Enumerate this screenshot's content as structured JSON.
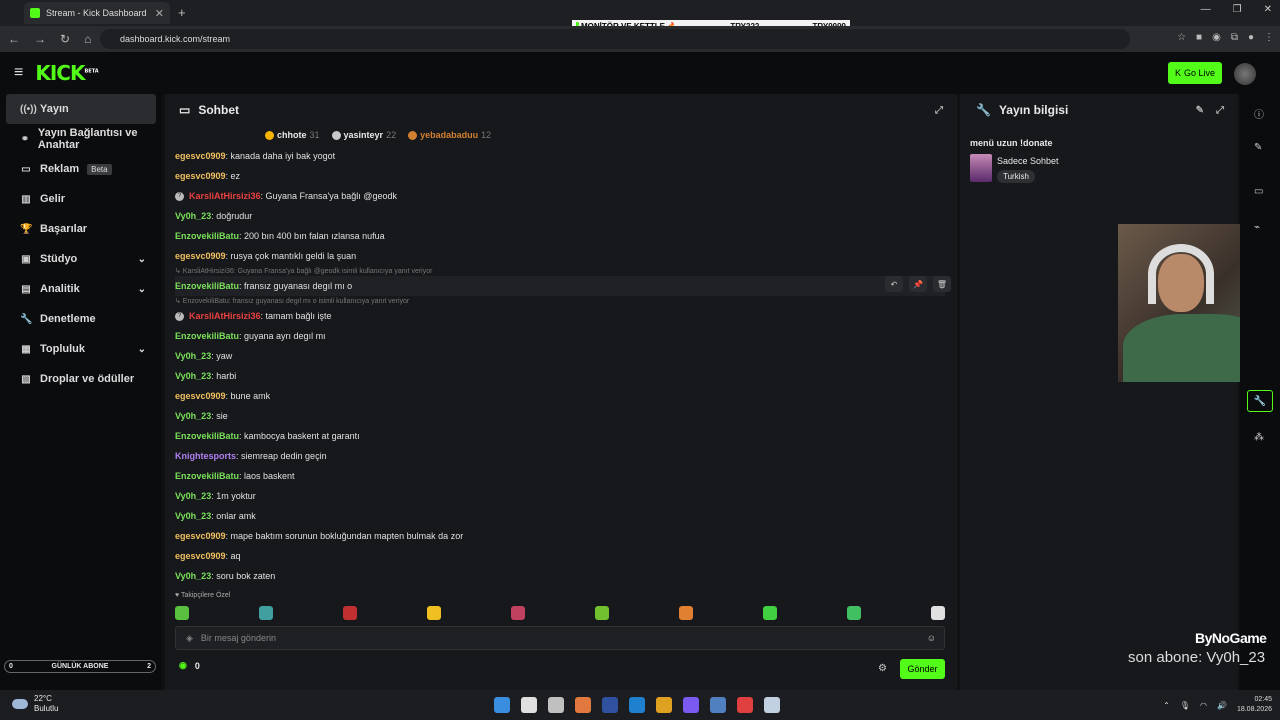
{
  "browser": {
    "tab_title": "Stream - Kick Dashboard",
    "tab_close": "✕",
    "new_tab": "+",
    "url": "dashboard.kick.com/stream",
    "window_controls": [
      "—",
      "❐",
      "✕"
    ]
  },
  "ticker": {
    "label": "MONİTÖR VE KETTLE 🔥",
    "a": "TRY222",
    "b": "TRY9999"
  },
  "header": {
    "logo": "KICK",
    "logo_sup": "BETA",
    "go_live": "Go Live"
  },
  "sidebar": {
    "items": [
      {
        "label": "Yayın",
        "icon": "((•))",
        "active": true
      },
      {
        "label": "Yayın Bağlantısı ve Anahtar",
        "icon": "⚭"
      },
      {
        "label": "Reklam",
        "icon": "▭",
        "badge": "Beta"
      },
      {
        "label": "Gelir",
        "icon": "▥"
      },
      {
        "label": "Başarılar",
        "icon": "🏆"
      },
      {
        "label": "Stüdyo",
        "icon": "▣",
        "chev": "⌄"
      },
      {
        "label": "Analitik",
        "icon": "▤",
        "chev": "⌄"
      },
      {
        "label": "Denetleme",
        "icon": "🔧"
      },
      {
        "label": "Topluluk",
        "icon": "▦",
        "chev": "⌄"
      },
      {
        "label": "Droplar ve ödüller",
        "icon": "▧"
      }
    ],
    "daily": {
      "left": "0",
      "label": "GÜNLÜK ABONE",
      "right": "2"
    }
  },
  "chat": {
    "title": "Sohbet",
    "leaders": [
      {
        "name": "chhote",
        "count": "31",
        "color": "#f5b400"
      },
      {
        "name": "yasinteyr",
        "count": "22",
        "color": "#c8c8c8"
      },
      {
        "name": "yebadabaduu",
        "count": "12",
        "color": "#d08030"
      }
    ],
    "messages": [
      {
        "user": "egesvc0909",
        "color": "#f0c060",
        "text": ": kanada daha iyi bak yogot"
      },
      {
        "user": "egesvc0909",
        "color": "#f0c060",
        "text": ": ez"
      },
      {
        "user": "KarsliAtHirsizi36",
        "color": "#e84040",
        "text": ": Guyana Fransa'ya bağlı @geodk",
        "badge": "?"
      },
      {
        "user": "Vy0h_23",
        "color": "#7ae05a",
        "text": ": doğrudur"
      },
      {
        "user": "EnzovekiliBatu",
        "color": "#7ae05a",
        "text": ": 200 bın 400 bın falan ızlansa nufua"
      },
      {
        "user": "egesvc0909",
        "color": "#f0c060",
        "text": ": rusya çok mantıklı geldi la şuan"
      },
      {
        "reply": "↳ KarsliAtHirsizi36: Guyana Fransa'ya bağlı @geodk isimli kullanıcıya yanıt veriyor"
      },
      {
        "user": "EnzovekiliBatu",
        "color": "#7ae05a",
        "text": ": fransız guyanası degıl mı o",
        "hover": true
      },
      {
        "reply": "↳ EnzovekiliBatu: fransız guyanası degıl mı o isimli kullanıcıya yanıt veriyor"
      },
      {
        "user": "KarsliAtHirsizi36",
        "color": "#e84040",
        "text": ": tamam bağlı işte",
        "badge": "?"
      },
      {
        "user": "EnzovekiliBatu",
        "color": "#7ae05a",
        "text": ": guyana ayrı degıl mı"
      },
      {
        "user": "Vy0h_23",
        "color": "#7ae05a",
        "text": ": yaw"
      },
      {
        "user": "Vy0h_23",
        "color": "#7ae05a",
        "text": ": harbi"
      },
      {
        "user": "egesvc0909",
        "color": "#f0c060",
        "text": ": bune amk"
      },
      {
        "user": "Vy0h_23",
        "color": "#7ae05a",
        "text": ": sie"
      },
      {
        "user": "EnzovekiliBatu",
        "color": "#7ae05a",
        "text": ": kambocya baskent at garantı"
      },
      {
        "user": "Knightesports",
        "color": "#b080f0",
        "text": ": siemreap dedin geçin"
      },
      {
        "user": "EnzovekiliBatu",
        "color": "#7ae05a",
        "text": ": laos baskent"
      },
      {
        "user": "Vy0h_23",
        "color": "#7ae05a",
        "text": ": 1m yoktur"
      },
      {
        "user": "Vy0h_23",
        "color": "#7ae05a",
        "text": ": onlar amk"
      },
      {
        "user": "egesvc0909",
        "color": "#f0c060",
        "text": ": mape baktım sorunun bokluğundan mapten bulmak da zor"
      },
      {
        "user": "egesvc0909",
        "color": "#f0c060",
        "text": ": aq"
      },
      {
        "user": "Vy0h_23",
        "color": "#7ae05a",
        "text": ": soru bok zaten"
      }
    ],
    "followers_only": "♥ Takipçilere Özel",
    "emote_colors": [
      "#5ac040",
      "#40a0a0",
      "#c03030",
      "#f0c020",
      "#c04060",
      "#70c030",
      "#e08030",
      "#40d040",
      "#40c060",
      "#e0e0e0"
    ],
    "placeholder": "Bir mesaj gönderin",
    "points": "0",
    "send": "Gönder"
  },
  "info": {
    "title": "Yayın bilgisi",
    "stream_title": "menü uzun !donate",
    "category": "Sadece Sohbet",
    "language": "Turkish"
  },
  "overlay": {
    "brand": "ByNoGame",
    "last_sub": "son abone: Vy0h_23"
  },
  "taskbar": {
    "temp": "22°C",
    "weather": "Bulutlu",
    "time": "02:45",
    "date": "18.08.2026",
    "app_colors": [
      "#3a8ee0",
      "#e0e0e0",
      "#c0c0c0",
      "#e07840",
      "#3050a0",
      "#2080d0",
      "#e0a020",
      "#7a5af0",
      "#5080c0",
      "#e04040",
      "#c0d0e0"
    ]
  }
}
